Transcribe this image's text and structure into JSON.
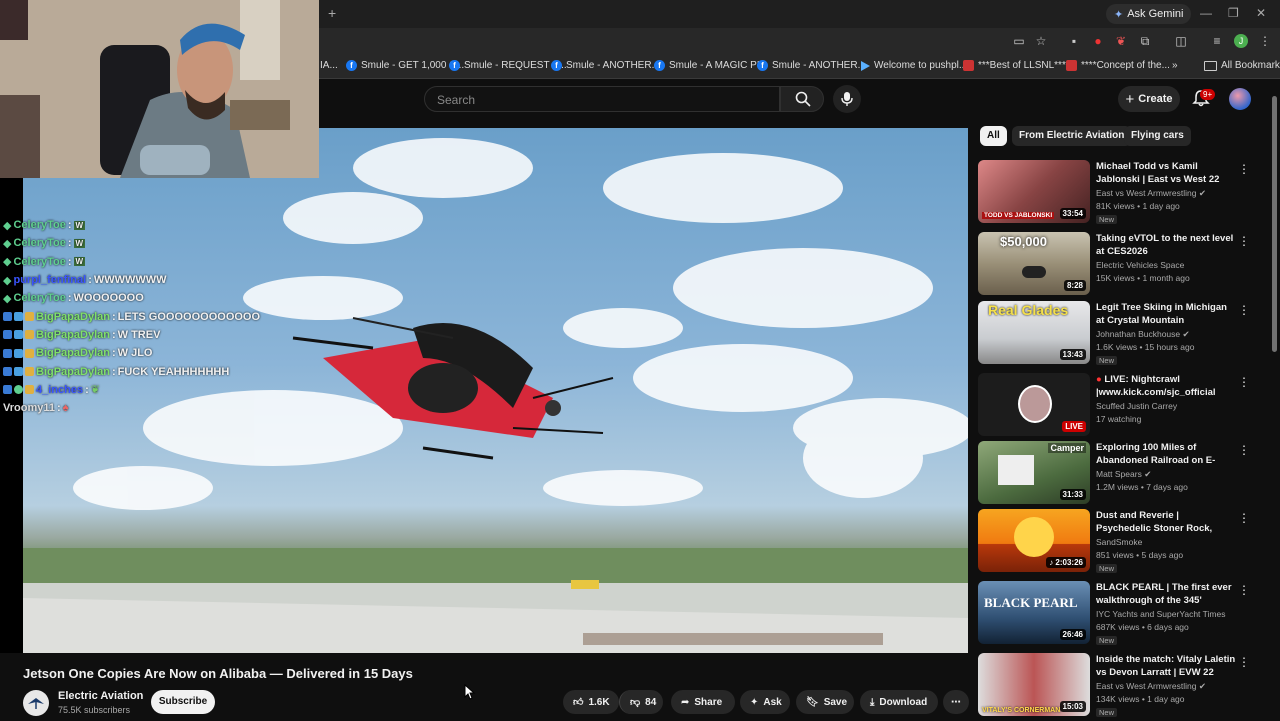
{
  "browser": {
    "new_tab": "+",
    "gemini_label": "Ask Gemini",
    "bookmarks": [
      "IA...",
      "Smule - GET 1,000 S...",
      "Smule - REQUEST A...",
      "Smule - ANOTHER...",
      "Smule - A MAGIC PI...",
      "Smule - ANOTHER...",
      "Welcome to pushpl...",
      "***Best of LLSNL***...",
      "****Concept of the...",
      "All Bookmarks"
    ],
    "more_bookmarks": "»"
  },
  "header": {
    "search_placeholder": "Search",
    "create_label": "Create",
    "notif_count": "9+"
  },
  "chat": [
    {
      "user": "CeleryToe",
      "msg": "W",
      "color": "#5fcf8f"
    },
    {
      "user": "CeleryToe",
      "msg": "W",
      "color": "#5fcf8f"
    },
    {
      "user": "CeleryToe",
      "msg": "W",
      "color": "#5fcf8f"
    },
    {
      "user": "purpl_fenfinal",
      "msg": "WWWWWWW",
      "color": "#3a55ff"
    },
    {
      "user": "CeleryToe",
      "msg": "WOOOOOOO",
      "color": "#5fcf8f"
    },
    {
      "user": "BigPapaDylan",
      "msg": "LETS GOOOOOOOOOOOO",
      "color": "#7fe06a"
    },
    {
      "user": "BigPapaDylan",
      "msg": "W TREV",
      "color": "#7fe06a"
    },
    {
      "user": "BigPapaDylan",
      "msg": "W JLO",
      "color": "#7fe06a"
    },
    {
      "user": "BigPapaDylan",
      "msg": "FUCK YEAHHHHHHH",
      "color": "#7fe06a"
    },
    {
      "user": "4_inches",
      "msg": "",
      "color": "#3a55ff"
    },
    {
      "user": "Vroomy11",
      "msg": "",
      "color": "#dddddd"
    }
  ],
  "video": {
    "title": "Jetson One Copies Are Now on Alibaba — Delivered in 15 Days",
    "channel": "Electric Aviation",
    "subscribers": "75.5K subscribers",
    "subscribe_label": "Subscribe",
    "likes": "1.6K",
    "dislikes": "84",
    "share_label": "Share",
    "ask_label": "Ask",
    "save_label": "Save",
    "download_label": "Download"
  },
  "chips": [
    "All",
    "From Electric Aviation",
    "Flying cars"
  ],
  "recommendations": [
    {
      "title": "Michael Todd vs Kamil Jablonski | East vs West 22 Fu...",
      "channel": "East vs West Armwrestling",
      "verified": true,
      "views": "81K views • 1 day ago",
      "badge": "New",
      "duration": "33:54",
      "thumb_text": "TODD VS JABLONSKI",
      "colors": [
        "#b33",
        "#433"
      ]
    },
    {
      "title": "Taking eVTOL to the next level at CES2026",
      "channel": "Electric Vehicles Space",
      "verified": false,
      "views": "15K views • 1 month ago",
      "badge": "",
      "duration": "8:28",
      "thumb_text": "$50,000",
      "colors": [
        "#998",
        "#554"
      ]
    },
    {
      "title": "Legit Tree Skiing in Michigan at Crystal Mountain",
      "channel": "Johnathan Buckhouse",
      "verified": true,
      "views": "1.6K views • 15 hours ago",
      "badge": "New",
      "duration": "13:43",
      "thumb_text": "Real Glades",
      "colors": [
        "#ddd",
        "#999"
      ]
    },
    {
      "title": "LIVE: Nightcrawl |www.kick.com/sjc_official",
      "channel": "Scuffed Justin Carrey",
      "verified": false,
      "views": "17 watching",
      "badge": "",
      "duration": "LIVE",
      "thumb_text": "",
      "colors": [
        "#222",
        "#111"
      ]
    },
    {
      "title": "Exploring 100 Miles of Abandoned Railroad on E-Bike...",
      "channel": "Matt Spears",
      "verified": true,
      "views": "1.2M views • 7 days ago",
      "badge": "",
      "duration": "31:33",
      "thumb_text": "Camper",
      "colors": [
        "#697",
        "#354"
      ]
    },
    {
      "title": "Dust and Reverie | Psychedelic Stoner Rock, Doom Metal Mix",
      "channel": "SandSmoke",
      "verified": false,
      "views": "851 views • 5 days ago",
      "badge": "New",
      "duration": "2:03:26",
      "thumb_text": "",
      "colors": [
        "#f80",
        "#b30"
      ]
    },
    {
      "title": "BLACK PEARL | The first ever walkthrough of the 345' (105m...",
      "channel": "IYC Yachts and SuperYacht Times",
      "verified": false,
      "views": "687K views • 6 days ago",
      "badge": "New",
      "duration": "26:46",
      "thumb_text": "BLACK PEARL",
      "colors": [
        "#468",
        "#135"
      ]
    },
    {
      "title": "Inside the match: Vitaly Laletin vs Devon Larratt | EVW 22",
      "channel": "East vs West Armwrestling",
      "verified": true,
      "views": "134K views • 1 day ago",
      "badge": "New",
      "duration": "15:03",
      "thumb_text": "VITALY'S CORNERMAN",
      "colors": [
        "#aaa",
        "#633"
      ]
    }
  ]
}
